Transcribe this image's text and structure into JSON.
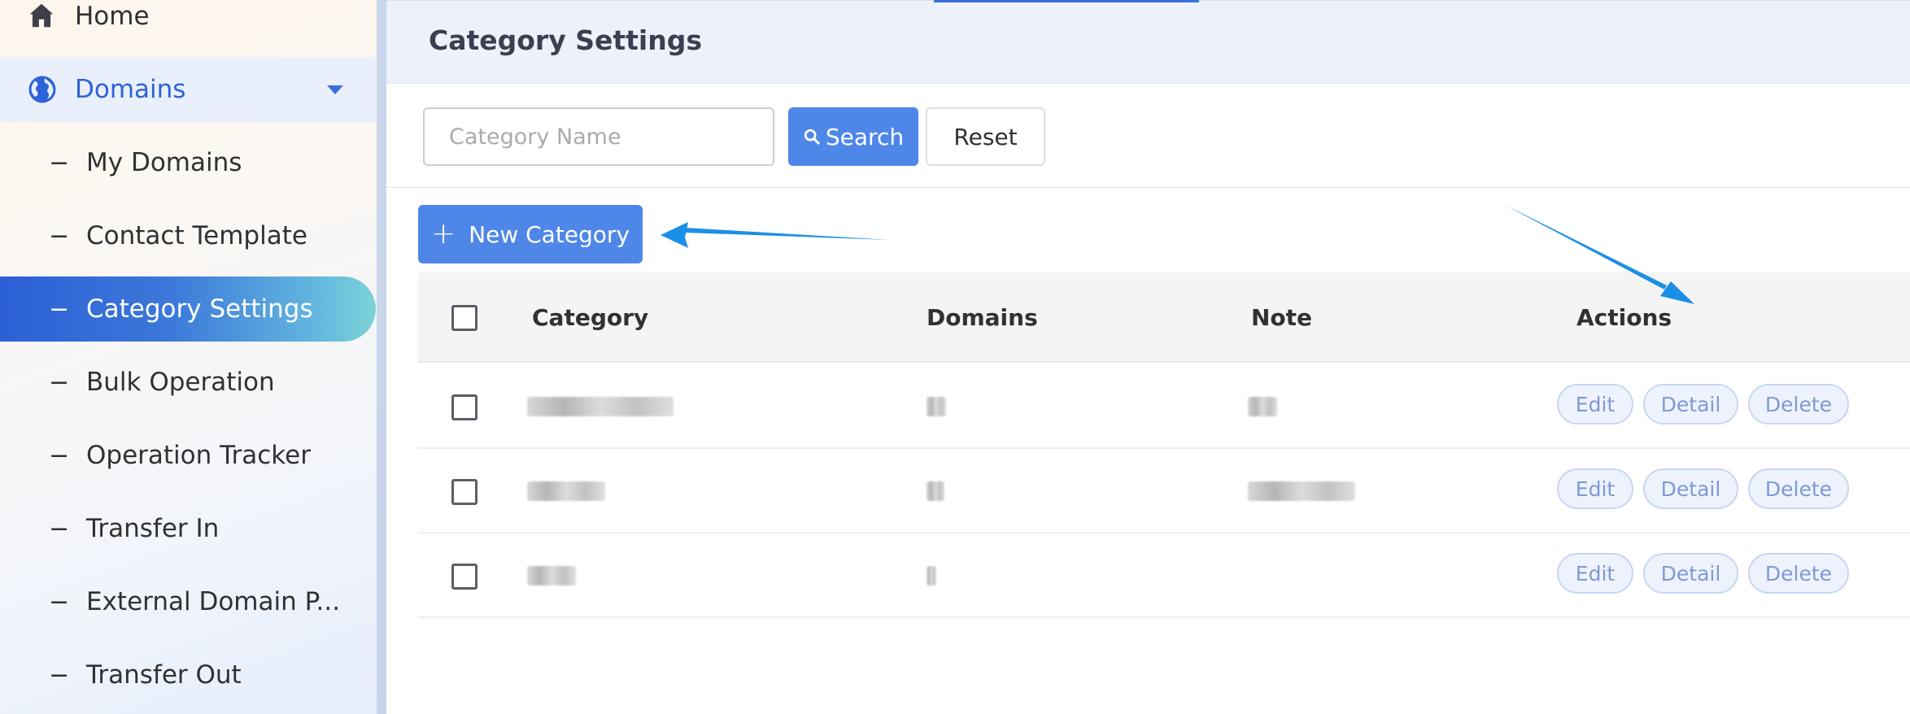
{
  "sidebar": {
    "home_label": "Home",
    "domains_label": "Domains",
    "items": [
      {
        "label": "My Domains"
      },
      {
        "label": "Contact Template"
      },
      {
        "label": "Category Settings"
      },
      {
        "label": "Bulk Operation"
      },
      {
        "label": "Operation Tracker"
      },
      {
        "label": "Transfer In"
      },
      {
        "label": "External Domain P..."
      },
      {
        "label": "Transfer Out"
      }
    ],
    "dash": "−",
    "active_item": "Category Settings"
  },
  "page": {
    "title": "Category Settings"
  },
  "search": {
    "placeholder": "Category Name",
    "search_label": "Search",
    "reset_label": "Reset"
  },
  "toolbar": {
    "new_label": "New Category"
  },
  "table": {
    "headers": {
      "category": "Category",
      "domains": "Domains",
      "note": "Note",
      "actions": "Actions"
    },
    "rows": [
      {
        "category": "(redacted)",
        "domains": "(redacted)",
        "note": "(redacted)"
      },
      {
        "category": "(redacted)",
        "domains": "(redacted)",
        "note": "(redacted)"
      },
      {
        "category": "(redacted)",
        "domains": "(redacted)",
        "note": ""
      }
    ],
    "row_actions": {
      "edit": "Edit",
      "detail": "Detail",
      "delete": "Delete"
    }
  },
  "colors": {
    "accent": "#4f87e8",
    "active_nav_start": "#2c5fd6",
    "active_nav_end": "#7ed3d6",
    "annotation_arrow": "#1a8fe6"
  }
}
